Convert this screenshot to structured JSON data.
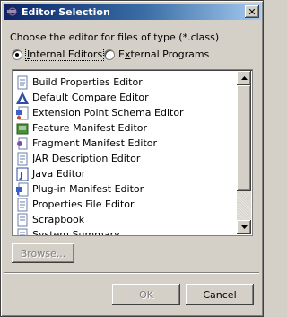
{
  "window": {
    "title": "Editor Selection",
    "close_glyph": "✕"
  },
  "prompt": "Choose the editor for files of type (*.class)",
  "radios": [
    {
      "label_hot": "I",
      "label_rest": "nternal Editors",
      "checked": true
    },
    {
      "label_pre": "E",
      "label_hot": "x",
      "label_rest": "ternal Programs",
      "checked": false
    }
  ],
  "editors": [
    {
      "label": "Build Properties Editor",
      "icon": "properties-file-icon"
    },
    {
      "label": "Default Compare Editor",
      "icon": "compare-editor-icon"
    },
    {
      "label": "Extension Point Schema Editor",
      "icon": "schema-editor-icon"
    },
    {
      "label": "Feature Manifest Editor",
      "icon": "feature-manifest-icon"
    },
    {
      "label": "Fragment Manifest Editor",
      "icon": "fragment-manifest-icon"
    },
    {
      "label": "JAR Description Editor",
      "icon": "jar-description-icon"
    },
    {
      "label": "Java Editor",
      "icon": "java-editor-icon"
    },
    {
      "label": "Plug-in Manifest Editor",
      "icon": "plugin-manifest-icon"
    },
    {
      "label": "Properties File Editor",
      "icon": "properties-file-icon"
    },
    {
      "label": "Scrapbook",
      "icon": "scrapbook-icon"
    },
    {
      "label": "System Summary",
      "icon": "system-summary-icon"
    }
  ],
  "buttons": {
    "browse": "Browse...",
    "ok": "OK",
    "cancel": "Cancel"
  }
}
